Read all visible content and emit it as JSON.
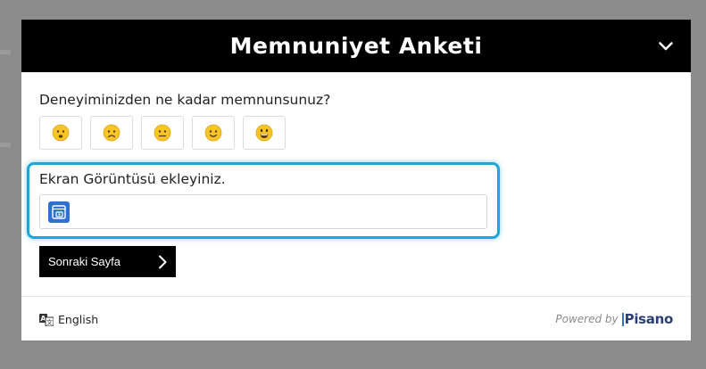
{
  "survey": {
    "title": "Memnuniyet Anketi",
    "question": "Deneyiminizden ne kadar memnunsunuz?",
    "ratings": [
      {
        "icon": "angry-face-icon"
      },
      {
        "icon": "sad-face-icon"
      },
      {
        "icon": "neutral-face-icon"
      },
      {
        "icon": "smile-face-icon"
      },
      {
        "icon": "grin-face-icon"
      }
    ],
    "upload_label": "Ekran Görüntüsü ekleyiniz.",
    "upload_icon": "screenshot-upload-icon",
    "next_label": "Sonraki Sayfa"
  },
  "footer": {
    "language": "English",
    "powered_by": "Powered by",
    "brand": "Pisano"
  },
  "colors": {
    "header_bg": "#000000",
    "highlight": "#1fa5d8",
    "upload_icon": "#2f6fce",
    "emoji_face": "#f7c528"
  }
}
